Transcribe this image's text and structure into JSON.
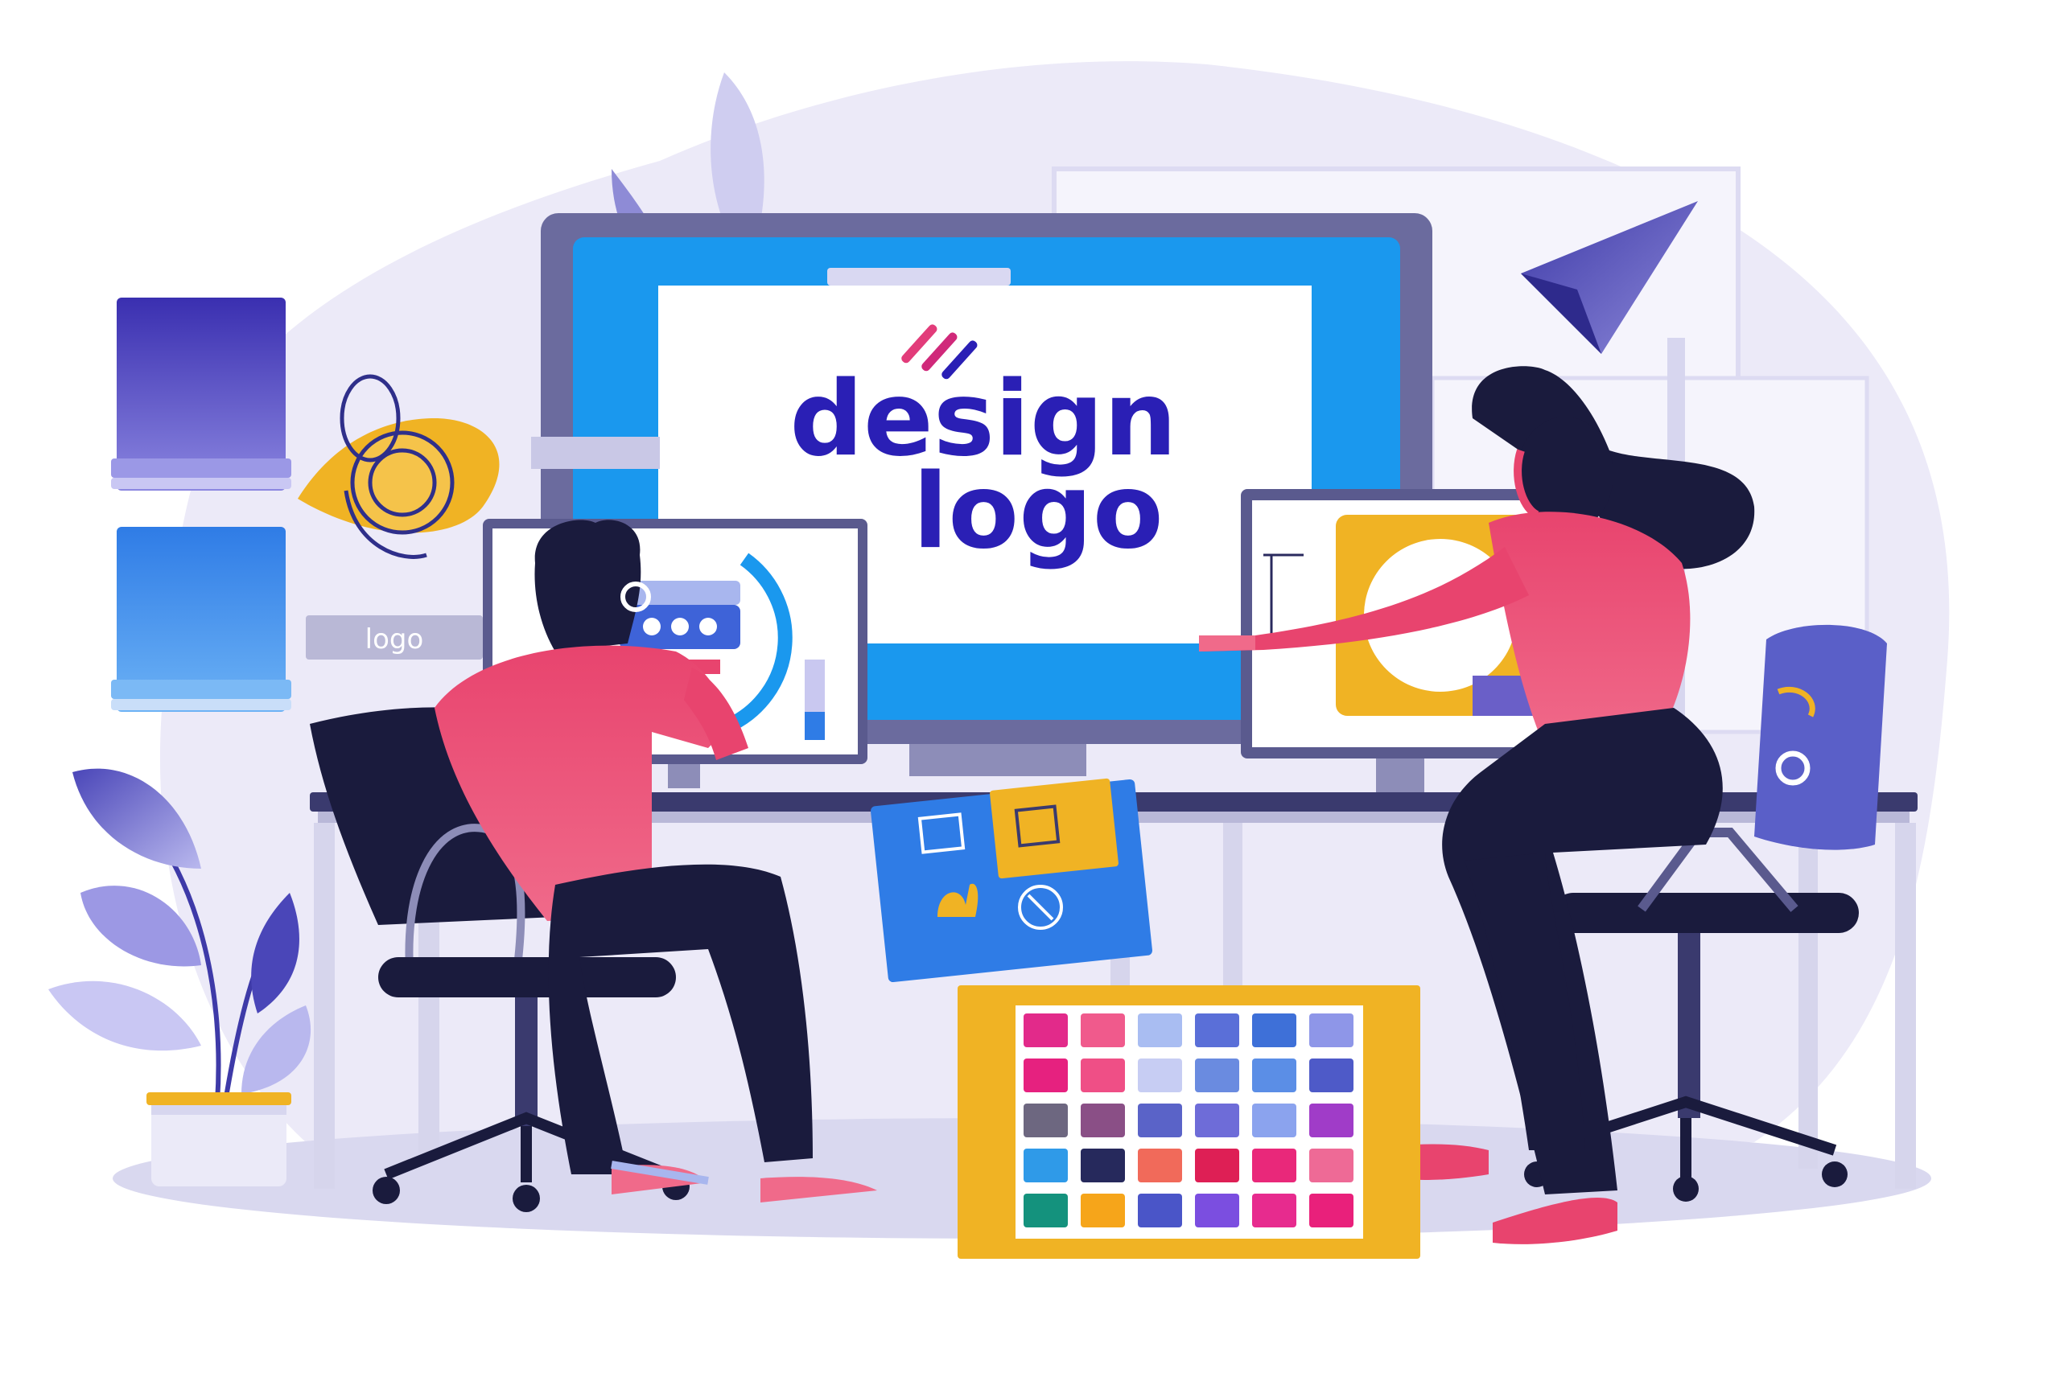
{
  "main_screen": {
    "word_top": "design",
    "word_bottom": "logo"
  },
  "wall_label": {
    "text": "logo"
  },
  "colors": {
    "background": "#ffffff",
    "backdrop": "#eceaf8",
    "monitor_frame": "#6b6b9e",
    "monitor_screen": "#1a98ee",
    "logo_text": "#2a1fb5",
    "logo_mark": "#e23c7a",
    "shirt": "#e8446e",
    "dark": "#1a1b3d",
    "accent_yellow": "#f0b324",
    "swatch_board": "#f0b324"
  },
  "swatches": [
    [
      "#e22a8a",
      "#f05a8c",
      "#a9bdf2",
      "#5a6fd8",
      "#3e70d8",
      "#8e96e8"
    ],
    [
      "#e6217f",
      "#ef4f86",
      "#c7cdf3",
      "#6a8be0",
      "#5b8ee6",
      "#4e5ac8"
    ],
    [
      "#6d6780",
      "#8a4f86",
      "#5a63c8",
      "#6e6cd8",
      "#8ba3ee",
      "#a03cc8"
    ],
    [
      "#2f9ae8",
      "#26295c",
      "#f16a5a",
      "#de1f55",
      "#e9287a",
      "#ee6a96"
    ],
    [
      "#14927d",
      "#f6a51a",
      "#4a55c8",
      "#7b4ee0",
      "#e72b8e",
      "#e9207b"
    ]
  ]
}
